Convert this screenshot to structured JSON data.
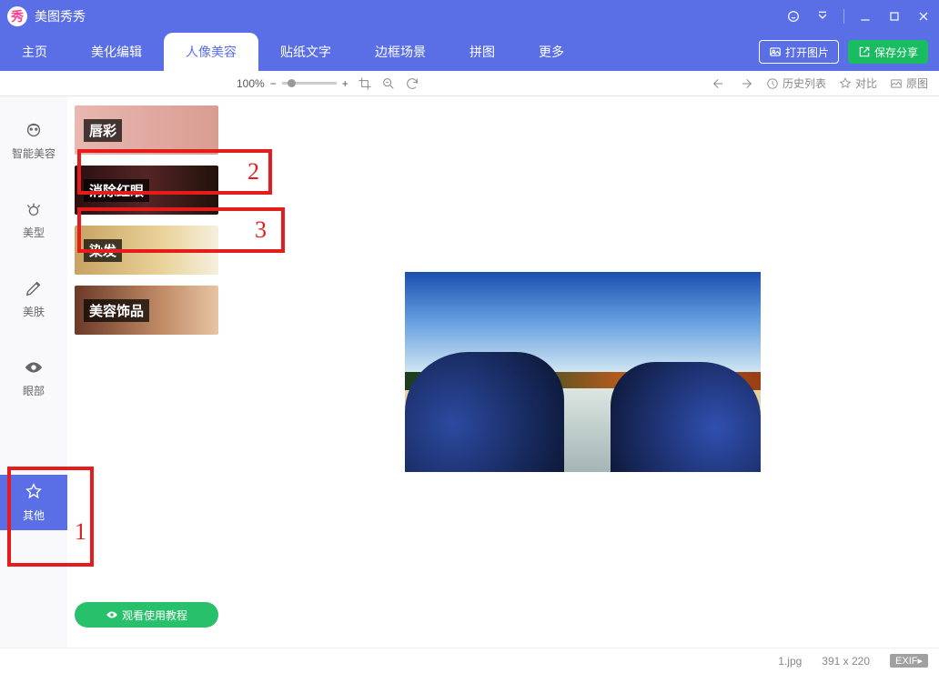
{
  "app_title": "美图秀秀",
  "titlebar_icons": [
    "msg-icon",
    "settings-icon",
    "sep",
    "minimize",
    "maximize",
    "close"
  ],
  "menu": {
    "items": [
      "主页",
      "美化编辑",
      "人像美容",
      "贴纸文字",
      "边框场景",
      "拼图",
      "更多"
    ],
    "active_index": 2,
    "open_btn": "打开图片",
    "save_btn": "保存分享"
  },
  "toolbar": {
    "zoom": "100%",
    "history": "历史列表",
    "compare": "对比",
    "original": "原图"
  },
  "sidenav": {
    "items": [
      {
        "label": "智能美容"
      },
      {
        "label": "美型"
      },
      {
        "label": "美肤"
      },
      {
        "label": "眼部"
      },
      {
        "label": "其他"
      }
    ],
    "active_index": 4
  },
  "toolpanel": {
    "items": [
      {
        "label": "唇彩"
      },
      {
        "label": "消除红眼"
      },
      {
        "label": "染发"
      },
      {
        "label": "美容饰品"
      }
    ],
    "tutorial": "观看使用教程"
  },
  "annotations": {
    "a1": "1",
    "a2": "2",
    "a3": "3"
  },
  "statusbar": {
    "filename": "1.jpg",
    "size": "391 x 220",
    "exif": "EXIF▸"
  }
}
